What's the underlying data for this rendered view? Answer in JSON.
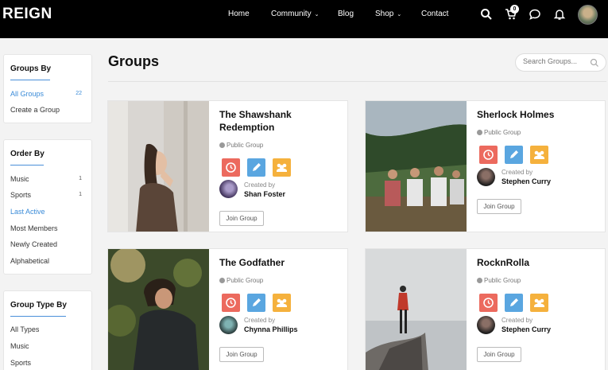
{
  "header": {
    "logo": "REIGN",
    "nav": [
      {
        "label": "Home",
        "caret": ""
      },
      {
        "label": "Community",
        "caret": "⌄"
      },
      {
        "label": "Blog",
        "caret": ""
      },
      {
        "label": "Shop",
        "caret": "⌄"
      },
      {
        "label": "Contact",
        "caret": ""
      }
    ],
    "cart_count": "0",
    "icons": [
      "search-icon",
      "cart-icon",
      "chat-icon",
      "bell-icon",
      "user-avatar"
    ]
  },
  "sidebar": {
    "groups_by": {
      "title": "Groups By",
      "items": [
        {
          "label": "All Groups",
          "count": "22",
          "active": true
        },
        {
          "label": "Create a Group",
          "count": "",
          "active": false
        }
      ]
    },
    "order_by": {
      "title": "Order By",
      "items": [
        {
          "label": "Music",
          "count": "1"
        },
        {
          "label": "Sports",
          "count": "1"
        },
        {
          "label": "Last Active",
          "count": ""
        },
        {
          "label": "Most Members",
          "count": ""
        },
        {
          "label": "Newly Created",
          "count": ""
        },
        {
          "label": "Alphabetical",
          "count": ""
        }
      ]
    },
    "group_type_by": {
      "title": "Group Type By",
      "items": [
        {
          "label": "All Types"
        },
        {
          "label": "Music"
        },
        {
          "label": "Sports"
        }
      ]
    }
  },
  "main": {
    "title": "Groups",
    "search_placeholder": "Search Groups..."
  },
  "groups": [
    {
      "title": "The Shawshank Redemption",
      "type": "Public Group",
      "created_label": "Created by",
      "creator": "Shan Foster",
      "join_label": "Join Group"
    },
    {
      "title": "Sherlock Holmes",
      "type": "Public Group",
      "created_label": "Created by",
      "creator": "Stephen Curry",
      "join_label": "Join Group"
    },
    {
      "title": "The Godfather",
      "type": "Public Group",
      "created_label": "Created by",
      "creator": "Chynna Phillips",
      "join_label": "Join Group"
    },
    {
      "title": "RocknRolla",
      "type": "Public Group",
      "created_label": "Created by",
      "creator": "Stephen Curry",
      "join_label": "Join Group"
    }
  ],
  "colors": {
    "accent": "#3a8bd8",
    "action_red": "#ec6a5e",
    "action_blue": "#5aa6e0",
    "action_orange": "#f5b13d"
  }
}
